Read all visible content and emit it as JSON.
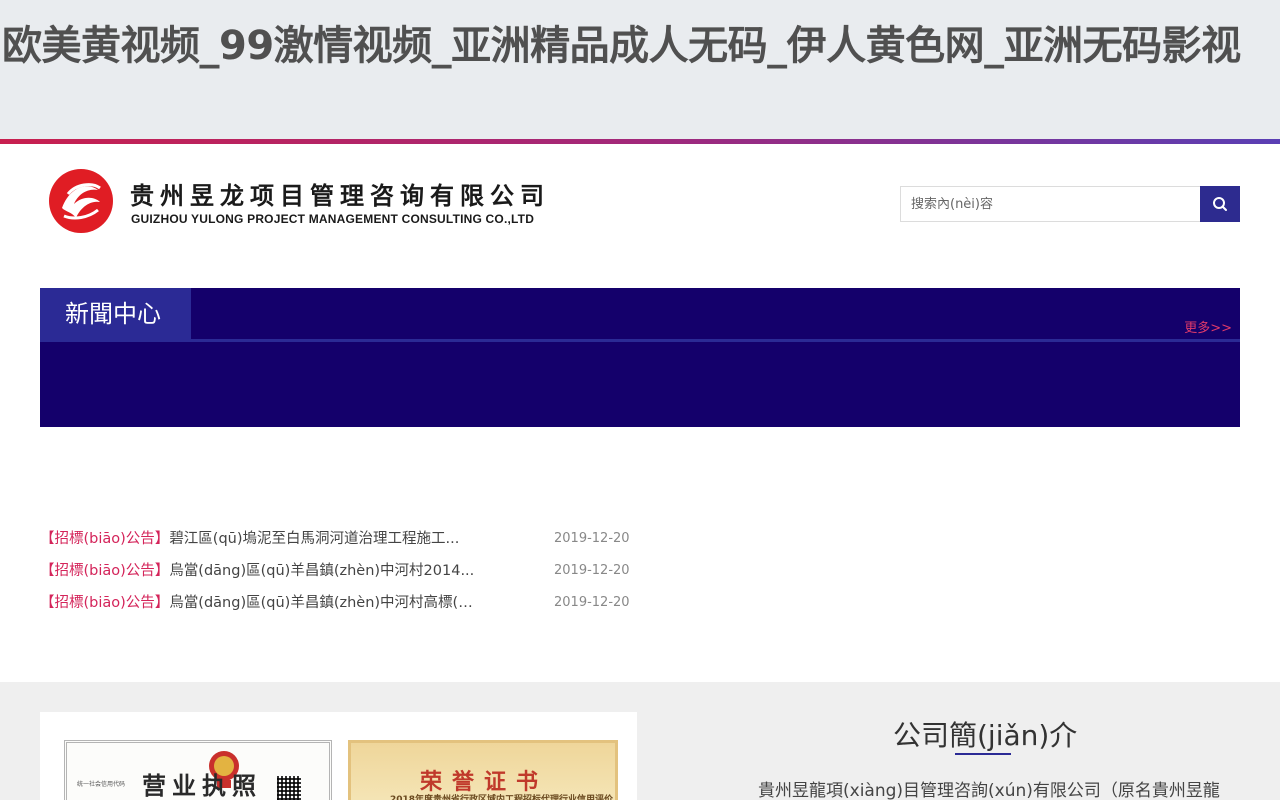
{
  "site_title": "欧美黄视频_99激情视频_亚洲精品成人无码_伊人黄色网_亚洲无码影视",
  "colors": {
    "accent_navy": "#14006b",
    "tab_blue": "#2b2a95",
    "tag_red": "#d4245a",
    "gradient": [
      "#c8204f",
      "#5a3fb4"
    ]
  },
  "header": {
    "logo_cn": "贵州昱龙项目管理咨询有限公司",
    "logo_en": "GUIZHOU YULONG PROJECT MANAGEMENT CONSULTING CO.,LTD",
    "logo_icon": "company-logo-icon",
    "search": {
      "placeholder": "搜索內(nèi)容",
      "button_icon": "search-icon"
    }
  },
  "news": {
    "tab_label": "新聞中心",
    "more_label": "更多>>",
    "items": [
      {
        "tag": "【招標(biāo)公告】",
        "title": "碧江區(qū)塢泥至白馬洞河道治理工程施工...",
        "date": "2019-12-20"
      },
      {
        "tag": "【招標(biāo)公告】",
        "title": "烏當(dāng)區(qū)羊昌鎮(zhèn)中河村2014...",
        "date": "2019-12-20"
      },
      {
        "tag": "【招標(biāo)公告】",
        "title": "烏當(dāng)區(qū)羊昌鎮(zhèn)中河村高標(b...",
        "date": "2019-12-20"
      }
    ]
  },
  "certificates": {
    "license_title": "营业执照",
    "license_small": "统一社会信用代码",
    "honor_title": "荣誉证书",
    "honor_sub": "2018年度贵州省行政区域内工程招标代理行业信用评价"
  },
  "intro": {
    "title": "公司簡(jiǎn)介",
    "text": "貴州昱龍項(xiàng)目管理咨詢(xún)有限公司（原名貴州昱龍"
  }
}
